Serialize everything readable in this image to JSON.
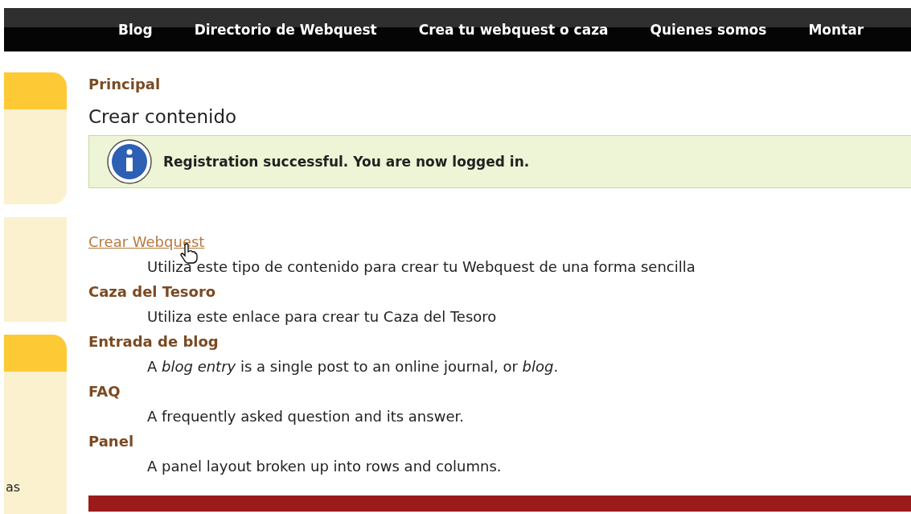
{
  "nav": [
    "Blog",
    "Directorio de Webquest",
    "Crea tu webquest o caza",
    "Quienes somos",
    "Montar"
  ],
  "breadcrumb": "Principal",
  "title": "Crear contenido",
  "message": "Registration successful. You are now logged in.",
  "items": [
    {
      "label": "Crear Webquest",
      "hovered": true,
      "description": "Utiliza este tipo de contenido para crear tu Webquest de una forma sencilla"
    },
    {
      "label": "Caza del Tesoro",
      "hovered": false,
      "description": "Utiliza este enlace para crear tu Caza del Tesoro"
    },
    {
      "label": "Entrada de blog",
      "hovered": false,
      "description": "A *blog entry* is a single post to an online journal, or *blog*."
    },
    {
      "label": "FAQ",
      "hovered": false,
      "description": "A frequently asked question and its answer."
    },
    {
      "label": "Panel",
      "hovered": false,
      "description": "A panel layout broken up into rows and columns."
    }
  ],
  "sidebar_text": "as"
}
